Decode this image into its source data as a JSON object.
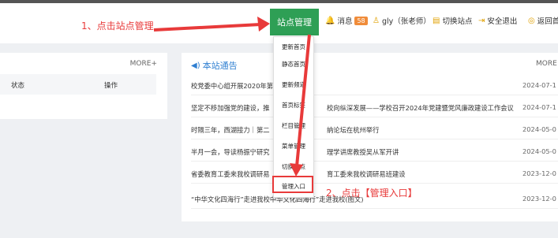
{
  "header": {
    "active_nav": "站点管理",
    "message_label": "消息",
    "message_count": "58",
    "user_label": "gly（张老师）",
    "switch_site": "切换站点",
    "logout": "安全退出",
    "back": "返回首"
  },
  "left_panel": {
    "more": "MORE+",
    "col_status": "状态",
    "col_action": "操作"
  },
  "notice": {
    "title": "本站通告",
    "more": "MORE",
    "items": [
      {
        "title": "校党委中心组开展2020年第",
        "date": "2024-07-1"
      },
      {
        "title": "坚定不移加强党的建设，推",
        "title2": "校向纵深发展——学校召开2024年党建暨党风廉政建设工作会议",
        "date": "2024-07-1"
      },
      {
        "title": "时隔三年，西湖接力｜第二",
        "title2": "纳论坛在杭州举行",
        "date": "2024-05-0"
      },
      {
        "title": "半月一会，导读杨振宁研究",
        "title2": "理学讲席教授吴从军开讲",
        "date": "2024-05-0"
      },
      {
        "title": "省委教育工委来我校调研易",
        "title2": "育工委来我校调研易班建设",
        "date": "2023-12-0"
      },
      {
        "title": "“中华文化四海行”走进我校中华文化四海行”走进我校(图文)",
        "date": "2023-12-0"
      }
    ]
  },
  "dropdown": {
    "items": [
      "更新首页",
      "静态首页",
      "更新频道",
      "首页标签",
      "栏目管理",
      "菜单管理",
      "切换站点",
      "管理入口"
    ]
  },
  "annotations": {
    "step1": "1、点击站点管理",
    "step2": "2、点击【管理入口】"
  },
  "colors": {
    "green": "#2e9f55",
    "red": "#e83a3a",
    "blue": "#2f7fd1",
    "badge": "#f08c3a"
  }
}
